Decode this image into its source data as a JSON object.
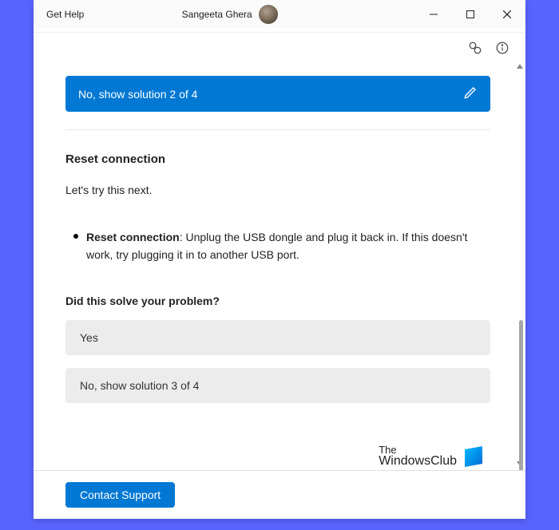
{
  "titlebar": {
    "app_title": "Get Help",
    "username": "Sangeeta Ghera"
  },
  "solution_bar": {
    "label": "No, show solution 2 of 4"
  },
  "article": {
    "title": "Reset connection",
    "subtitle": "Let's try this next.",
    "bullet_strong": "Reset connection",
    "bullet_rest": ": Unplug the USB dongle and plug it back in. If this doesn't work, try plugging it in to another USB port."
  },
  "prompt": {
    "question": "Did this solve your problem?",
    "yes": "Yes",
    "no": "No, show solution 3 of 4"
  },
  "watermark": {
    "line1": "The",
    "line2": "WindowsClub"
  },
  "footer": {
    "contact_label": "Contact Support"
  }
}
